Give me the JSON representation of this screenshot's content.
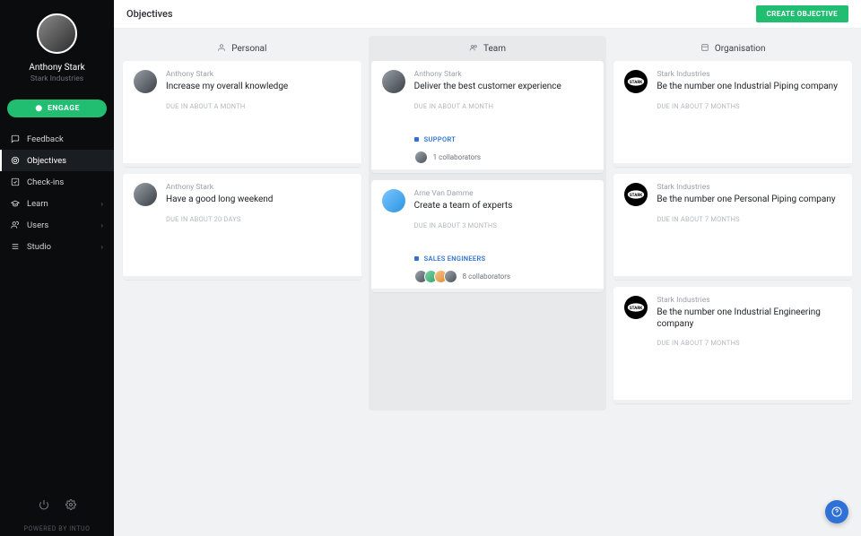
{
  "sidebar": {
    "user_name": "Anthony Stark",
    "user_org": "Stark Industries",
    "engage_label": "ENGAGE",
    "nav": [
      {
        "label": "Feedback",
        "expandable": false
      },
      {
        "label": "Objectives",
        "expandable": false
      },
      {
        "label": "Check-ins",
        "expandable": false
      },
      {
        "label": "Learn",
        "expandable": true
      },
      {
        "label": "Users",
        "expandable": true
      },
      {
        "label": "Studio",
        "expandable": true
      }
    ],
    "powered": "POWERED BY INTUO"
  },
  "page": {
    "title": "Objectives",
    "create_button": "CREATE OBJECTIVE"
  },
  "columns": {
    "personal": {
      "label": "Personal"
    },
    "team": {
      "label": "Team"
    },
    "organisation": {
      "label": "Organisation"
    }
  },
  "cards": {
    "p1": {
      "owner": "Anthony Stark",
      "title": "Increase my overall knowledge",
      "due": "DUE IN ABOUT A MONTH"
    },
    "p2": {
      "owner": "Anthony Stark",
      "title": "Have a good long weekend",
      "due": "DUE IN ABOUT 20 DAYS"
    },
    "t1": {
      "owner": "Anthony Stark",
      "title": "Deliver the best customer experience",
      "due": "DUE IN ABOUT A MONTH",
      "tag": "SUPPORT",
      "tag_color": "#2f71d6",
      "collab": "1 collaborators"
    },
    "t2": {
      "owner": "Arne Van Damme",
      "title": "Create a team of experts",
      "due": "DUE IN ABOUT 3 MONTHS",
      "tag": "SALES ENGINEERS",
      "tag_color": "#2f71d6",
      "collab": "8 collaborators"
    },
    "o1": {
      "owner": "Stark Industries",
      "title": "Be the number one Industrial Piping company",
      "due": "DUE IN ABOUT 7 MONTHS"
    },
    "o2": {
      "owner": "Stark Industries",
      "title": "Be the number one Personal Piping company",
      "due": "DUE IN ABOUT 7 MONTHS"
    },
    "o3": {
      "owner": "Stark Industries",
      "title": "Be the number one Industrial Engineering company",
      "due": "DUE IN ABOUT 7 MONTHS"
    }
  }
}
